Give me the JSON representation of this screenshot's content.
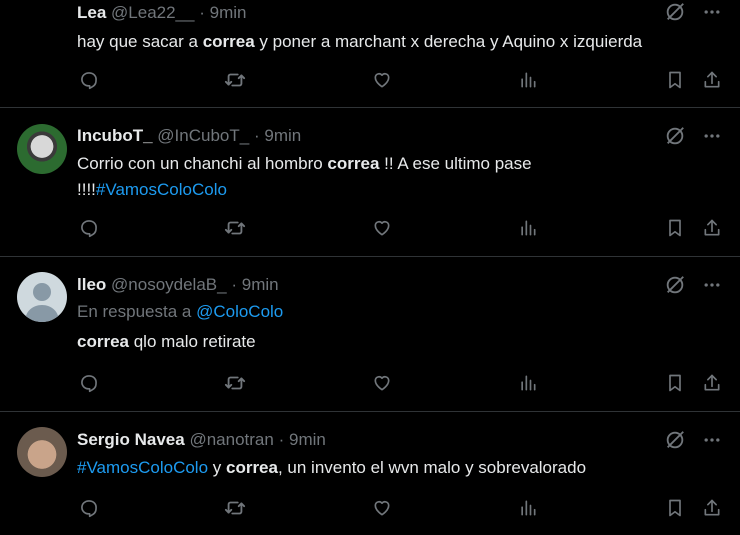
{
  "tweets": [
    {
      "name": "Lea",
      "handle": "@Lea22__",
      "sep": "·",
      "time": "9min",
      "segments": [
        {
          "t": "hay que sacar a ",
          "s": "plain"
        },
        {
          "t": "correa",
          "s": "bold"
        },
        {
          "t": " y poner a marchant x derecha y Aquino x izquierda",
          "s": "plain"
        }
      ]
    },
    {
      "name": "IncuboT_",
      "handle": "@InCuboT_",
      "sep": "·",
      "time": "9min",
      "line1": [
        {
          "t": "Corrio con un chanchi al hombro ",
          "s": "plain"
        },
        {
          "t": "correa",
          "s": "bold"
        },
        {
          "t": " !!  A ese ultimo pase",
          "s": "plain"
        }
      ],
      "line2": [
        {
          "t": "!!!!",
          "s": "plain"
        },
        {
          "t": "#VamosColoColo",
          "s": "link"
        }
      ]
    },
    {
      "name": "lleo",
      "handle": "@nosoydelaB_",
      "sep": "·",
      "time": "9min",
      "reply_prefix": "En respuesta a ",
      "reply_handle": "@ColoColo",
      "segments": [
        {
          "t": "correa",
          "s": "bold"
        },
        {
          "t": " qlo malo retirate",
          "s": "plain"
        }
      ]
    },
    {
      "name": "Sergio Navea",
      "handle": "@nanotran",
      "sep": "·",
      "time": "9min",
      "segments": [
        {
          "t": "#VamosColoColo",
          "s": "link"
        },
        {
          "t": " y ",
          "s": "plain"
        },
        {
          "t": "correa",
          "s": "bold"
        },
        {
          "t": ", un invento el wvn malo y sobrevalorado",
          "s": "plain"
        }
      ]
    }
  ],
  "colors": {
    "background": "#000000",
    "text": "#e7e9ea",
    "muted": "#71767b",
    "link": "#1d9bf0",
    "divider": "#2f3336"
  },
  "icons": [
    "grok-icon",
    "more-icon",
    "reply-icon",
    "retweet-icon",
    "like-icon",
    "views-icon",
    "bookmark-icon",
    "share-icon"
  ]
}
